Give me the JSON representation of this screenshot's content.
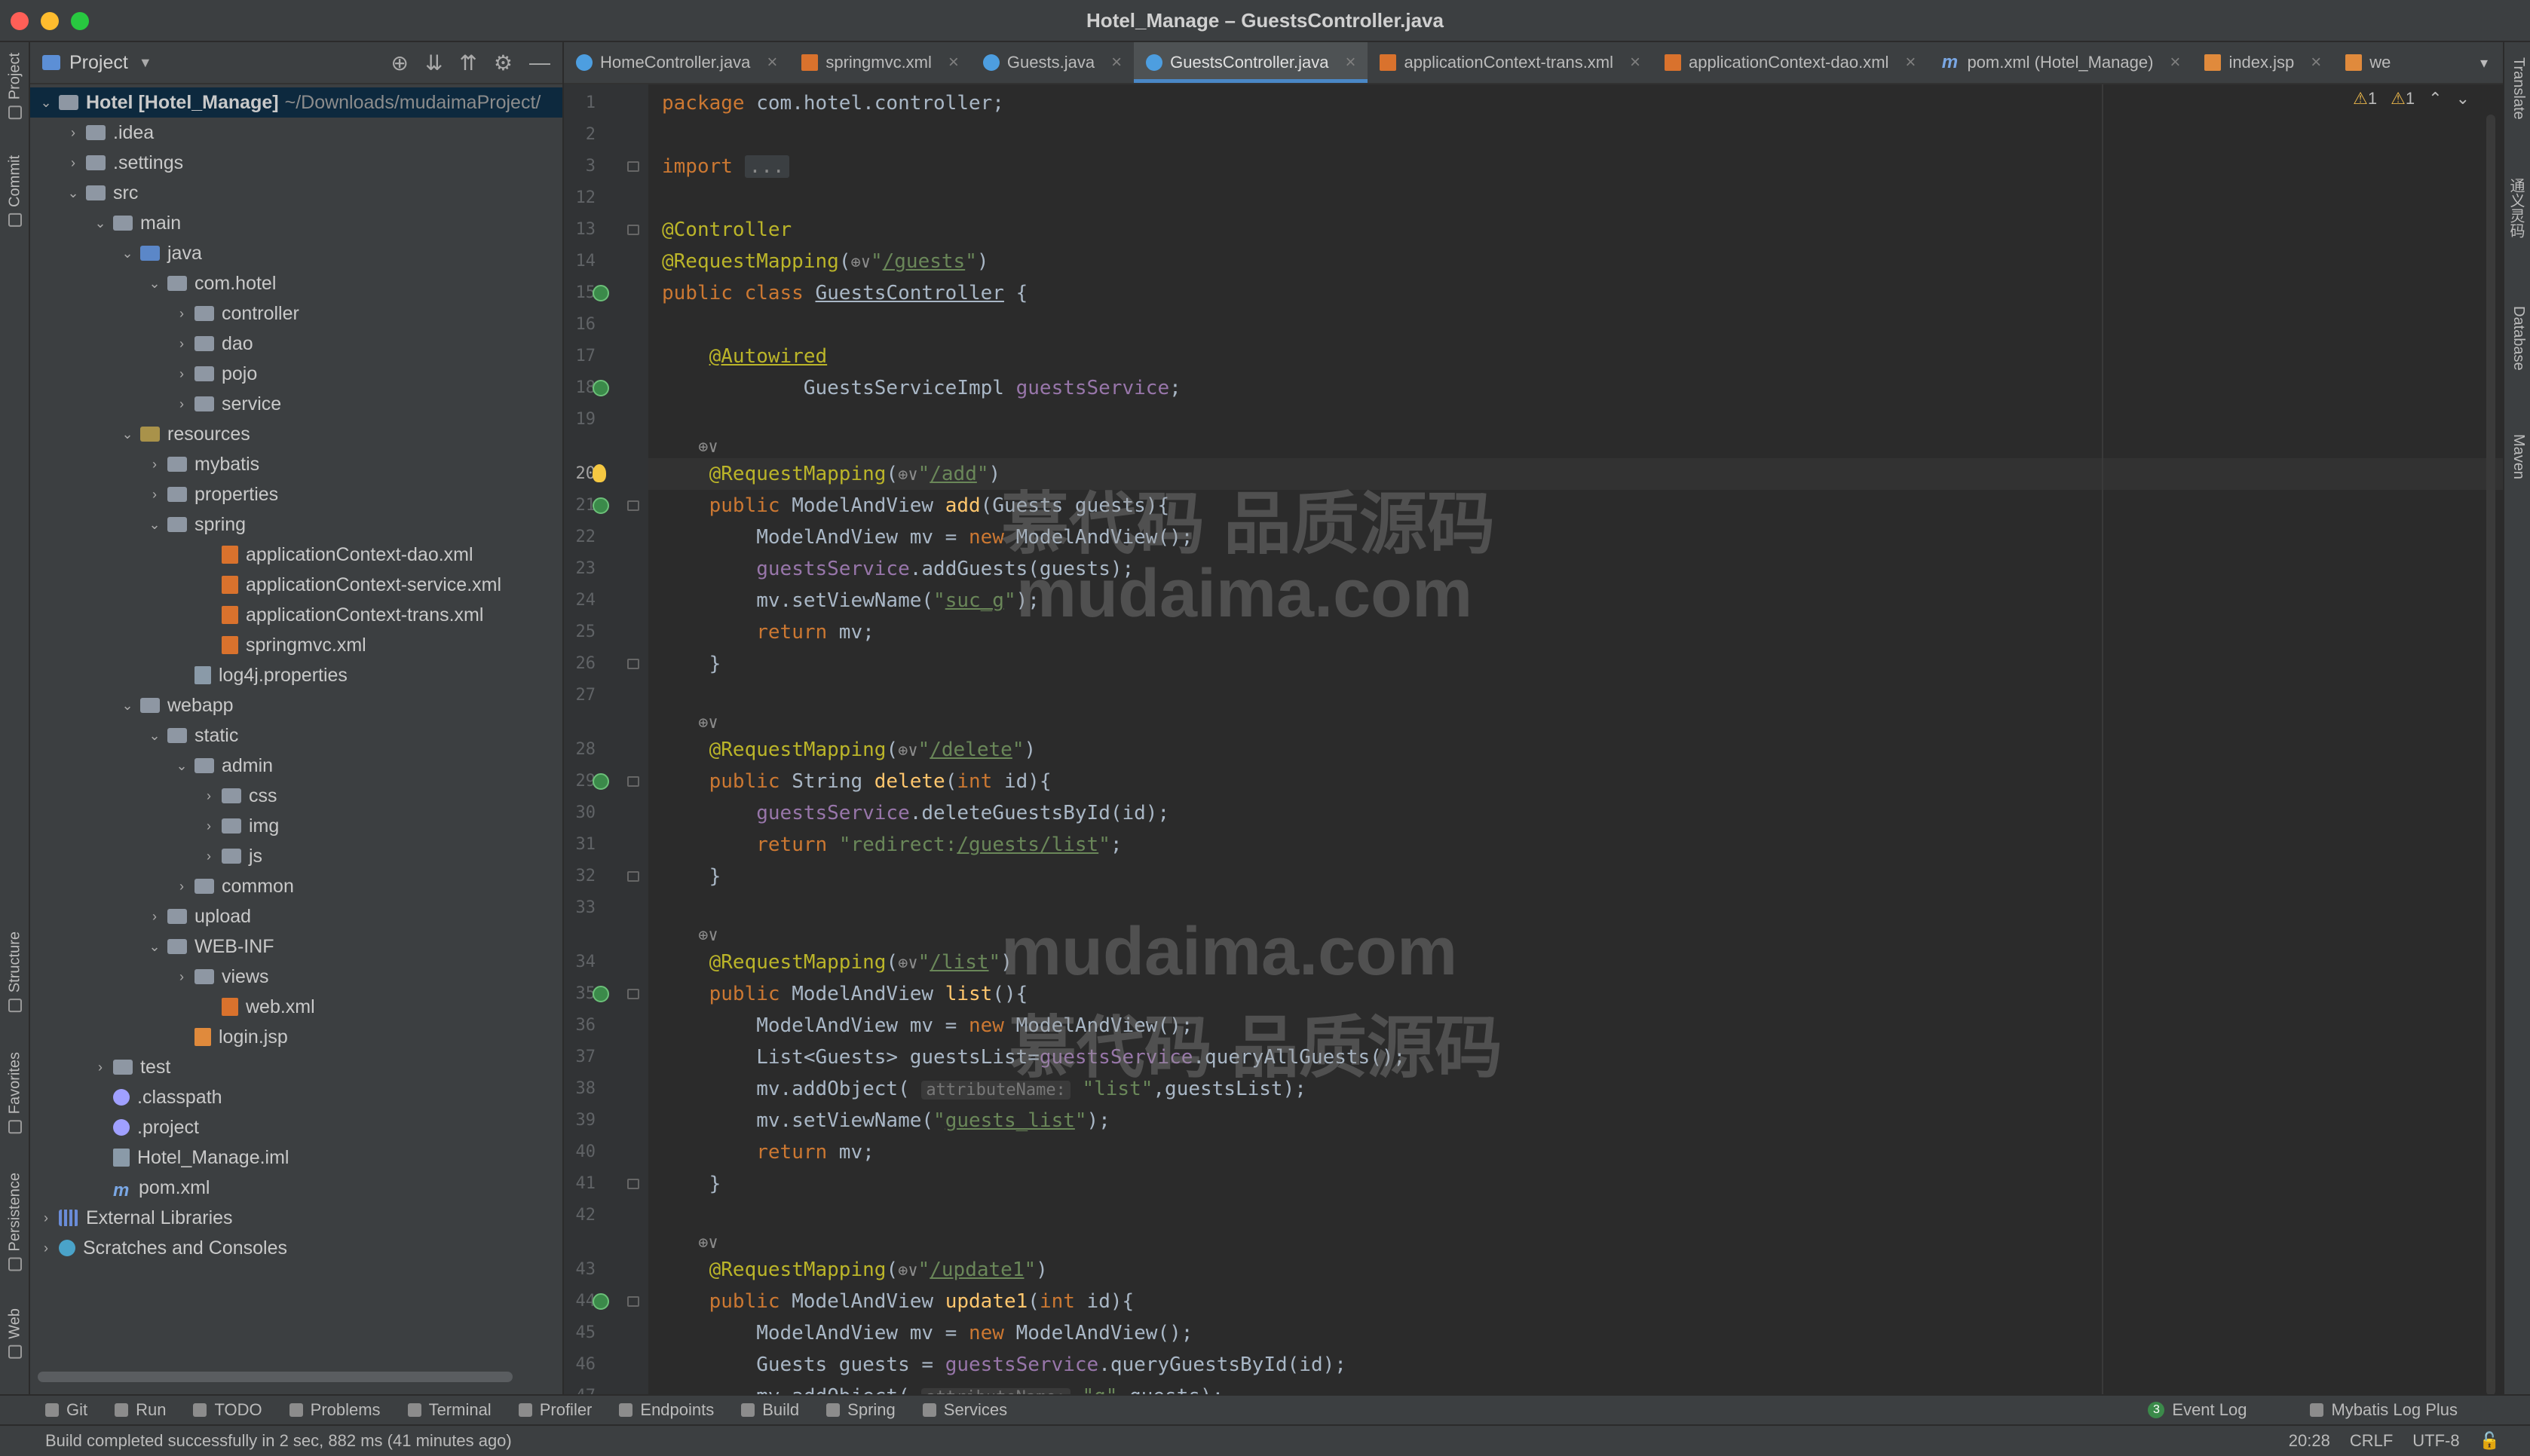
{
  "window": {
    "title": "Hotel_Manage – GuestsController.java"
  },
  "left_strip": {
    "tabs": [
      "Project",
      "Commit",
      "Structure",
      "Favorites",
      "Persistence",
      "Web"
    ]
  },
  "right_strip": {
    "tabs": [
      "Translate",
      "通义灵码",
      "Database",
      "Maven"
    ]
  },
  "project": {
    "header": "Project",
    "tree": [
      {
        "label": "Hotel [Hotel_Manage]",
        "extra": "~/Downloads/mudaimaProject/",
        "depth": 0,
        "arrow": "open",
        "icon": "folder"
      },
      {
        "label": ".idea",
        "depth": 1,
        "arrow": "closed",
        "icon": "folder"
      },
      {
        "label": ".settings",
        "depth": 1,
        "arrow": "closed",
        "icon": "folder"
      },
      {
        "label": "src",
        "depth": 1,
        "arrow": "open",
        "icon": "folder"
      },
      {
        "label": "main",
        "depth": 2,
        "arrow": "open",
        "icon": "folder"
      },
      {
        "label": "java",
        "depth": 3,
        "arrow": "open",
        "icon": "folder-src"
      },
      {
        "label": "com.hotel",
        "depth": 4,
        "arrow": "open",
        "icon": "folder"
      },
      {
        "label": "controller",
        "depth": 5,
        "arrow": "closed",
        "icon": "folder"
      },
      {
        "label": "dao",
        "depth": 5,
        "arrow": "closed",
        "icon": "folder"
      },
      {
        "label": "pojo",
        "depth": 5,
        "arrow": "closed",
        "icon": "folder"
      },
      {
        "label": "service",
        "depth": 5,
        "arrow": "closed",
        "icon": "folder"
      },
      {
        "label": "resources",
        "depth": 3,
        "arrow": "open",
        "icon": "folder-res"
      },
      {
        "label": "mybatis",
        "depth": 4,
        "arrow": "closed",
        "icon": "folder"
      },
      {
        "label": "properties",
        "depth": 4,
        "arrow": "closed",
        "icon": "folder"
      },
      {
        "label": "spring",
        "depth": 4,
        "arrow": "open",
        "icon": "folder"
      },
      {
        "label": "applicationContext-dao.xml",
        "depth": 6,
        "arrow": "none",
        "icon": "xml"
      },
      {
        "label": "applicationContext-service.xml",
        "depth": 6,
        "arrow": "none",
        "icon": "xml"
      },
      {
        "label": "applicationContext-trans.xml",
        "depth": 6,
        "arrow": "none",
        "icon": "xml"
      },
      {
        "label": "springmvc.xml",
        "depth": 6,
        "arrow": "none",
        "icon": "xml"
      },
      {
        "label": "log4j.properties",
        "depth": 5,
        "arrow": "none",
        "icon": "prop"
      },
      {
        "label": "webapp",
        "depth": 3,
        "arrow": "open",
        "icon": "folder"
      },
      {
        "label": "static",
        "depth": 4,
        "arrow": "open",
        "icon": "folder"
      },
      {
        "label": "admin",
        "depth": 5,
        "arrow": "open",
        "icon": "folder"
      },
      {
        "label": "css",
        "depth": 6,
        "arrow": "closed",
        "icon": "folder"
      },
      {
        "label": "img",
        "depth": 6,
        "arrow": "closed",
        "icon": "folder"
      },
      {
        "label": "js",
        "depth": 6,
        "arrow": "closed",
        "icon": "folder"
      },
      {
        "label": "common",
        "depth": 5,
        "arrow": "closed",
        "icon": "folder"
      },
      {
        "label": "upload",
        "depth": 4,
        "arrow": "closed",
        "icon": "folder"
      },
      {
        "label": "WEB-INF",
        "depth": 4,
        "arrow": "open",
        "icon": "folder"
      },
      {
        "label": "views",
        "depth": 5,
        "arrow": "closed",
        "icon": "folder"
      },
      {
        "label": "web.xml",
        "depth": 6,
        "arrow": "none",
        "icon": "xml"
      },
      {
        "label": "login.jsp",
        "depth": 5,
        "arrow": "none",
        "icon": "jsp"
      },
      {
        "label": "test",
        "depth": 2,
        "arrow": "closed",
        "icon": "folder"
      },
      {
        "label": ".classpath",
        "depth": 2,
        "arrow": "none",
        "icon": "gen"
      },
      {
        "label": ".project",
        "depth": 2,
        "arrow": "none",
        "icon": "gen"
      },
      {
        "label": "Hotel_Manage.iml",
        "depth": 2,
        "arrow": "none",
        "icon": "prop"
      },
      {
        "label": "pom.xml",
        "depth": 2,
        "arrow": "none",
        "icon": "m"
      },
      {
        "label": "External Libraries",
        "depth": 0,
        "arrow": "closed",
        "icon": "lib"
      },
      {
        "label": "Scratches and Consoles",
        "depth": 0,
        "arrow": "closed",
        "icon": "scr"
      }
    ]
  },
  "tabs": [
    {
      "label": "HomeController.java",
      "icon": "class",
      "active": false
    },
    {
      "label": "springmvc.xml",
      "icon": "xml",
      "active": false
    },
    {
      "label": "Guests.java",
      "icon": "class",
      "active": false
    },
    {
      "label": "GuestsController.java",
      "icon": "class",
      "active": true
    },
    {
      "label": "applicationContext-trans.xml",
      "icon": "xml",
      "active": false
    },
    {
      "label": "applicationContext-dao.xml",
      "icon": "xml",
      "active": false
    },
    {
      "label": "pom.xml (Hotel_Manage)",
      "icon": "m",
      "active": false
    },
    {
      "label": "index.jsp",
      "icon": "jsp",
      "active": false
    },
    {
      "label": "we",
      "icon": "jsp",
      "active": false
    }
  ],
  "editor": {
    "warnings": [
      "1",
      "1"
    ],
    "current_line": "20",
    "lines": [
      {
        "n": "1",
        "html": "<span class='kw'>package</span> com.hotel.controller;"
      },
      {
        "n": "2",
        "html": ""
      },
      {
        "n": "3",
        "html": "<span class='kw'>import</span> <span class='fold-dots'>...</span>",
        "fold": true
      },
      {
        "n": "12",
        "html": ""
      },
      {
        "n": "13",
        "html": "<span class='ann'>@Controller</span>",
        "fold": true
      },
      {
        "n": "14",
        "html": "<span class='ann'>@RequestMapping</span>(<span class='globe'>⊕∨</span><span class='str'>\"<span class='ul'>/guests</span>\"</span>)"
      },
      {
        "n": "15",
        "html": "<span class='kw'>public class</span> <span class='ul'>GuestsController</span> {",
        "mark": true
      },
      {
        "n": "16",
        "html": ""
      },
      {
        "n": "17",
        "html": "    <span class='ann ul'>@Autowired</span>"
      },
      {
        "n": "18",
        "html": "            GuestsServiceImpl <span class='fld'>guestsService</span>;",
        "mark": true
      },
      {
        "n": "19",
        "html": ""
      },
      {
        "n": "",
        "html": "    <span class='globe'>⊕∨</span>",
        "lens": true
      },
      {
        "n": "20",
        "html": "    <span class='ann'>@RequestMapping</span>(<span class='globe'>⊕∨</span><span class='str'>\"<span class='ul'>/add</span>\"</span>)",
        "bulb": true,
        "current": true
      },
      {
        "n": "21",
        "html": "    <span class='kw'>public</span> ModelAndView <span class='mth'>add</span>(Guests guests){",
        "mark": true,
        "fold": true
      },
      {
        "n": "22",
        "html": "        ModelAndView mv = <span class='kw'>new</span> ModelAndView();"
      },
      {
        "n": "23",
        "html": "        <span class='fld'>guestsService</span>.addGuests(guests);"
      },
      {
        "n": "24",
        "html": "        mv.setViewName(<span class='str'>\"<span class='ul'>suc_g</span>\"</span>);"
      },
      {
        "n": "25",
        "html": "        <span class='kw'>return</span> mv;"
      },
      {
        "n": "26",
        "html": "    }",
        "fold": true
      },
      {
        "n": "27",
        "html": ""
      },
      {
        "n": "",
        "html": "    <span class='globe'>⊕∨</span>",
        "lens": true
      },
      {
        "n": "28",
        "html": "    <span class='ann'>@RequestMapping</span>(<span class='globe'>⊕∨</span><span class='str'>\"<span class='ul'>/delete</span>\"</span>)"
      },
      {
        "n": "29",
        "html": "    <span class='kw'>public</span> String <span class='mth'>delete</span>(<span class='kw'>int</span> id){",
        "mark": true,
        "fold": true
      },
      {
        "n": "30",
        "html": "        <span class='fld'>guestsService</span>.deleteGuestsById(id);"
      },
      {
        "n": "31",
        "html": "        <span class='kw'>return</span> <span class='str'>\"redirect:<span class='ul'>/guests/list</span>\"</span>;"
      },
      {
        "n": "32",
        "html": "    }",
        "fold": true
      },
      {
        "n": "33",
        "html": ""
      },
      {
        "n": "",
        "html": "    <span class='globe'>⊕∨</span>",
        "lens": true
      },
      {
        "n": "34",
        "html": "    <span class='ann'>@RequestMapping</span>(<span class='globe'>⊕∨</span><span class='str'>\"<span class='ul'>/list</span>\"</span>)"
      },
      {
        "n": "35",
        "html": "    <span class='kw'>public</span> ModelAndView <span class='mth'>list</span>(){",
        "mark": true,
        "fold": true
      },
      {
        "n": "36",
        "html": "        ModelAndView mv = <span class='kw'>new</span> ModelAndView();"
      },
      {
        "n": "37",
        "html": "        List&lt;Guests&gt; guestsList=<span class='fld'>guestsService</span>.queryAllGuests();"
      },
      {
        "n": "38",
        "html": "        mv.addObject( <span class='hint'>attributeName:</span> <span class='str'>\"list\"</span>,guestsList);"
      },
      {
        "n": "39",
        "html": "        mv.setViewName(<span class='str'>\"<span class='ul'>guests_list</span>\"</span>);"
      },
      {
        "n": "40",
        "html": "        <span class='kw'>return</span> mv;"
      },
      {
        "n": "41",
        "html": "    }",
        "fold": true
      },
      {
        "n": "42",
        "html": ""
      },
      {
        "n": "",
        "html": "    <span class='globe'>⊕∨</span>",
        "lens": true
      },
      {
        "n": "43",
        "html": "    <span class='ann'>@RequestMapping</span>(<span class='globe'>⊕∨</span><span class='str'>\"<span class='ul'>/update1</span>\"</span>)"
      },
      {
        "n": "44",
        "html": "    <span class='kw'>public</span> ModelAndView <span class='mth'>update1</span>(<span class='kw'>int</span> id){",
        "mark": true,
        "fold": true
      },
      {
        "n": "45",
        "html": "        ModelAndView mv = <span class='kw'>new</span> ModelAndView();"
      },
      {
        "n": "46",
        "html": "        Guests guests = <span class='fld'>guestsService</span>.queryGuestsById(id);"
      },
      {
        "n": "47",
        "html": "        mv.addObject( <span class='hint'>attributeName:</span> <span class='str'>\"g\"</span>,guests);"
      }
    ]
  },
  "watermark": {
    "line1": "慕代码 品质源码",
    "line2": "mudaima.com",
    "line3": "mudaima.com",
    "line4": "慕代码 品质源码"
  },
  "bottom_tools": [
    "Git",
    "Run",
    "TODO",
    "Problems",
    "Terminal",
    "Profiler",
    "Endpoints",
    "Build",
    "Spring",
    "Services"
  ],
  "bottom_right": {
    "event_log": "Event Log",
    "event_count": "3",
    "mybatis": "Mybatis Log Plus"
  },
  "status": {
    "message": "Build completed successfully in 2 sec, 882 ms (41 minutes ago)",
    "position": "20:28",
    "line_sep": "CRLF",
    "encoding": "UTF-8"
  }
}
